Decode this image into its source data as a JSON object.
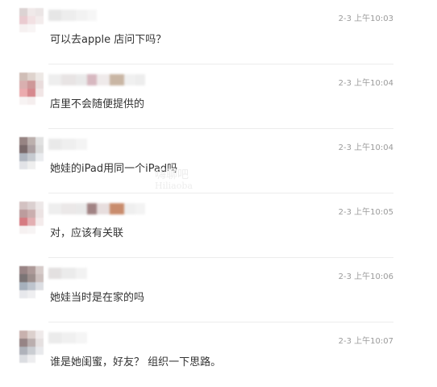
{
  "comments": [
    {
      "time": "2-3 上午10:03",
      "text": "可以去apple 店问下吗？",
      "avatar_colors": [
        "#d9cfcf",
        "#efe7e7",
        "#e9e3e3",
        "#e8c6cc",
        "#f1dee1",
        "#f2eaea",
        "#f6f0f0",
        "#f8f4f4",
        "#ffffff",
        "#ffffff",
        "#ffffff",
        "#ffffff"
      ],
      "name_colors": [
        "#e6e6e6",
        "#ededed",
        "#f2f2f2",
        "#f6f6f6"
      ]
    },
    {
      "time": "2-3 上午10:04",
      "text": "店里不会随便提供的",
      "avatar_colors": [
        "#cbb8b0",
        "#dccfc8",
        "#ece6e3",
        "#d5a7a7",
        "#c98d8f",
        "#e7d9d9",
        "#e9a3a6",
        "#d27d82",
        "#f0e3e3",
        "#f7f2f2",
        "#f5eded",
        "#ffffff"
      ],
      "name_colors": [
        "#eeeeee",
        "#e8e4e4",
        "#e9e9e9",
        "#d7b8c0",
        "#efeaea",
        "#c9b6a4",
        "#f0f0f0",
        "#ededed"
      ]
    },
    {
      "time": "2-3 上午10:04",
      "text": "她娃的iPad用同一个iPad吗",
      "avatar_colors": [
        "#8c7776",
        "#b5a8a5",
        "#dedede",
        "#6c5a5c",
        "#a39597",
        "#d7d7d7",
        "#a7aeb9",
        "#c0c5cc",
        "#e8eaee",
        "#dfe1e5",
        "#eeeeee",
        "#ffffff"
      ],
      "name_colors": [
        "#e9e9e9",
        "#efefef",
        "#f4f4f4"
      ]
    },
    {
      "time": "2-3 上午10:05",
      "text": "对，应该有关联",
      "avatar_colors": [
        "#cfbcbc",
        "#d8cccc",
        "#ece6e6",
        "#b59293",
        "#c5a6a6",
        "#ebe0e0",
        "#d26d74",
        "#e0a7aa",
        "#f3e9e9",
        "#f6f0f0",
        "#f7f3f3",
        "#ffffff"
      ],
      "name_colors": [
        "#eeeeee",
        "#ebe8e8",
        "#e9e9e9",
        "#a18384",
        "#e7dede",
        "#c98c6d",
        "#efefef",
        "#f3f3f3"
      ]
    },
    {
      "time": "2-3 上午10:06",
      "text": "她娃当时是在家的吗",
      "avatar_colors": [
        "#8e7778",
        "#a58f8d",
        "#d2c6c4",
        "#6d6667",
        "#938381",
        "#c7bab8",
        "#9da8b5",
        "#b7bec8",
        "#d9dbe0",
        "#e5e6ea",
        "#eeeef0",
        "#ffffff"
      ],
      "name_colors": [
        "#e3e0e0",
        "#ebebeb",
        "#f2f2f2"
      ]
    },
    {
      "time": "2-3 上午10:07",
      "text": "谁是她闺蜜，好友？ 组织一下思路。",
      "avatar_colors": [
        "#c3a9a6",
        "#d9cbc8",
        "#eee8e8",
        "#8b7778",
        "#b3a6a6",
        "#e3dddd",
        "#a7aab3",
        "#c5c8ce",
        "#e6e7ea",
        "#d8dade",
        "#ececee",
        "#ffffff"
      ],
      "name_colors": [
        "#ebebeb",
        "#f0f0f0",
        "#f5f5f5"
      ]
    }
  ],
  "watermark": {
    "main": "嗨聊吧",
    "sub": "Hiliaoba"
  }
}
